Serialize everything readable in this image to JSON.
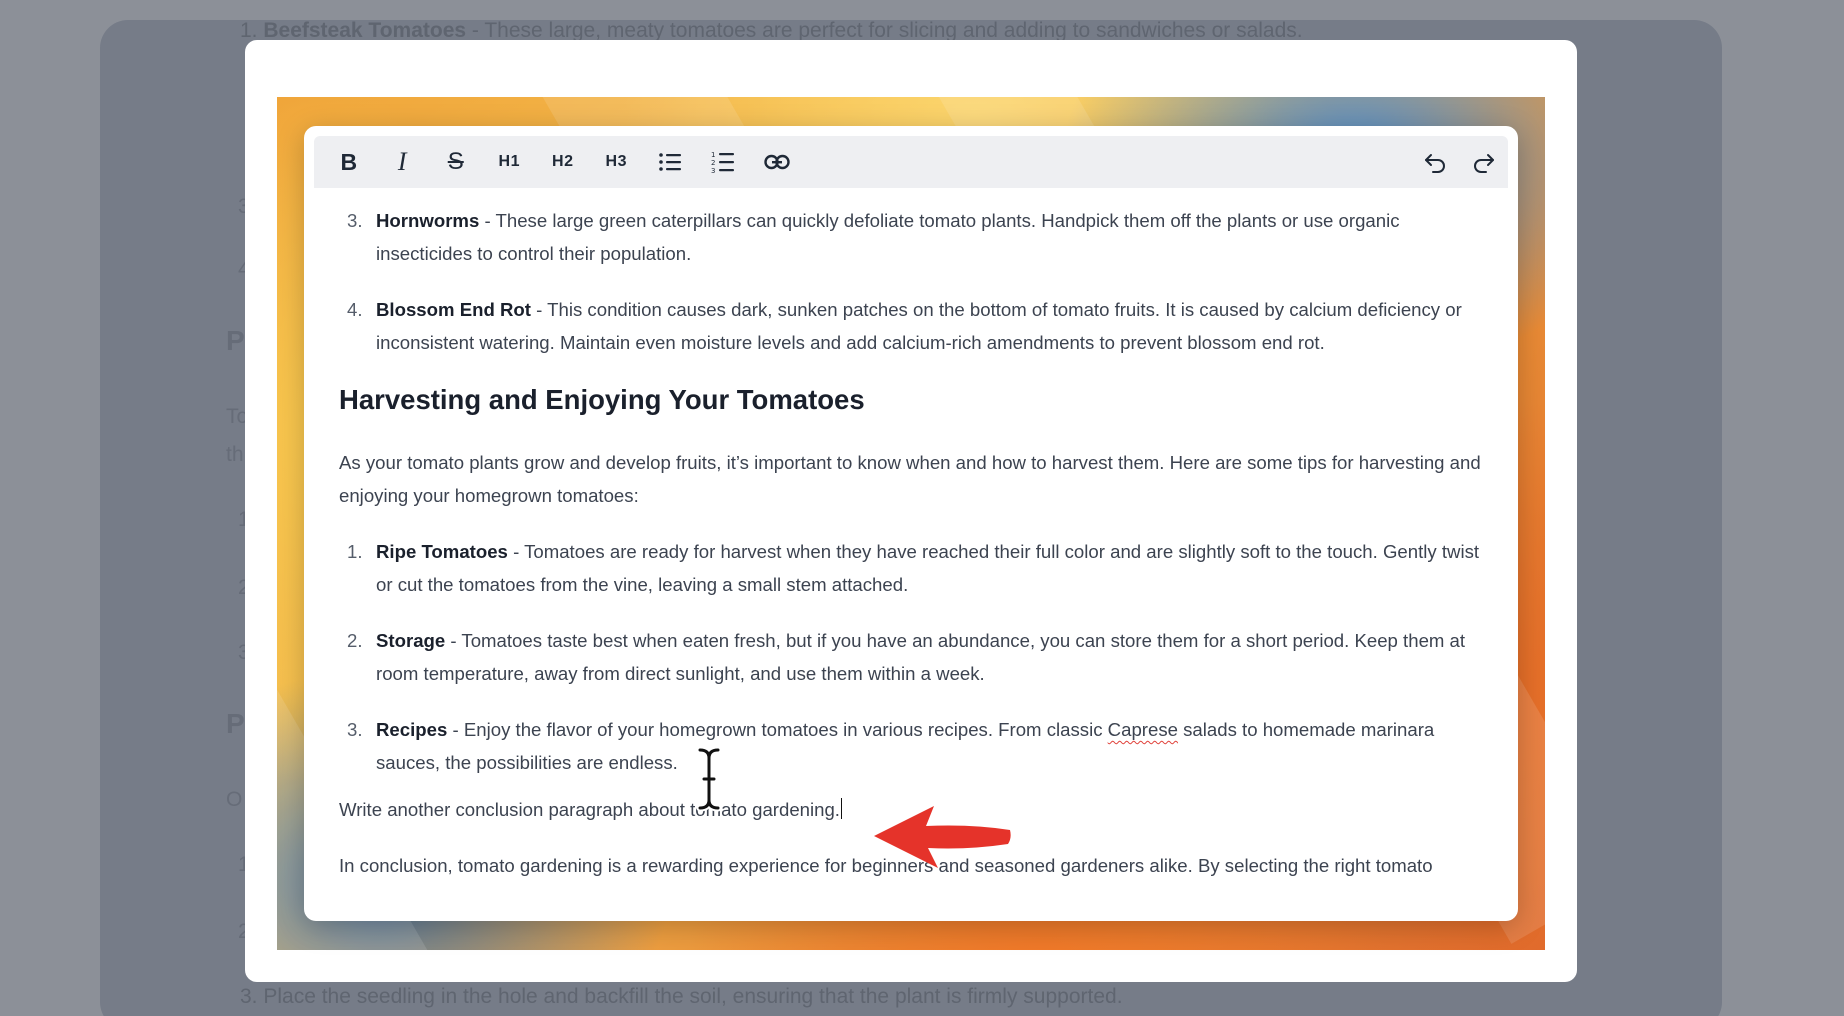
{
  "background_page": {
    "top_item": {
      "number": "1.",
      "title": "Beefsteak Tomatoes",
      "text": " - These large, meaty tomatoes are perfect for slicing and adding to sandwiches or salads."
    },
    "bottom_item": {
      "number": "3.",
      "text": "Place the seedling in the hole and backfill the soil, ensuring that the plant is firmly supported."
    },
    "fragments": [
      "3",
      "4",
      "P",
      "To",
      "th",
      "1",
      "2",
      "3",
      "P",
      "O",
      "1",
      "2"
    ]
  },
  "toolbar": {
    "bold": "B",
    "italic": "I",
    "strike": "S",
    "h1": "H1",
    "h2": "H2",
    "h3": "H3",
    "icons": [
      "bullet-list-icon",
      "ordered-list-icon",
      "link-icon",
      "undo-icon",
      "redo-icon"
    ]
  },
  "document": {
    "pests_list": [
      {
        "number": "3.",
        "title": "Hornworms",
        "text": " - These large green caterpillars can quickly defoliate tomato plants. Handpick them off the plants or use organic insecticides to control their population."
      },
      {
        "number": "4.",
        "title": "Blossom End Rot",
        "text": " - This condition causes dark, sunken patches on the bottom of tomato fruits. It is caused by calcium deficiency or inconsistent watering. Maintain even moisture levels and add calcium-rich amendments to prevent blossom end rot."
      }
    ],
    "heading": "Harvesting and Enjoying Your Tomatoes",
    "intro": "As your tomato plants grow and develop fruits, it’s important to know when and how to harvest them. Here are some tips for harvesting and enjoying your homegrown tomatoes:",
    "harvest_list": [
      {
        "number": "1.",
        "title": "Ripe Tomatoes",
        "text": " - Tomatoes are ready for harvest when they have reached their full color and are slightly soft to the touch. Gently twist or cut the tomatoes from the vine, leaving a small stem attached."
      },
      {
        "number": "2.",
        "title": "Storage",
        "text": " - Tomatoes taste best when eaten fresh, but if you have an abundance, you can store them for a short period. Keep them at room temperature, away from direct sunlight, and use them within a week."
      }
    ],
    "recipes_item": {
      "number": "3.",
      "title": "Recipes",
      "text_before": " - Enjoy the flavor of your homegrown tomatoes in various recipes. From classic ",
      "misspelled": "Caprese",
      "text_after": " salads to homemade marinara sauces, the possibilities are endless."
    },
    "prompt_line": "Write another conclusion paragraph about tomato gardening.",
    "conclusion": "In conclusion, tomato gardening is a rewarding experience for beginners and seasoned gardeners alike. By selecting the right tomato"
  },
  "colors": {
    "arrow": "#e5332a",
    "toolbar_bg": "#eeeff2",
    "heading": "#1a202c"
  }
}
